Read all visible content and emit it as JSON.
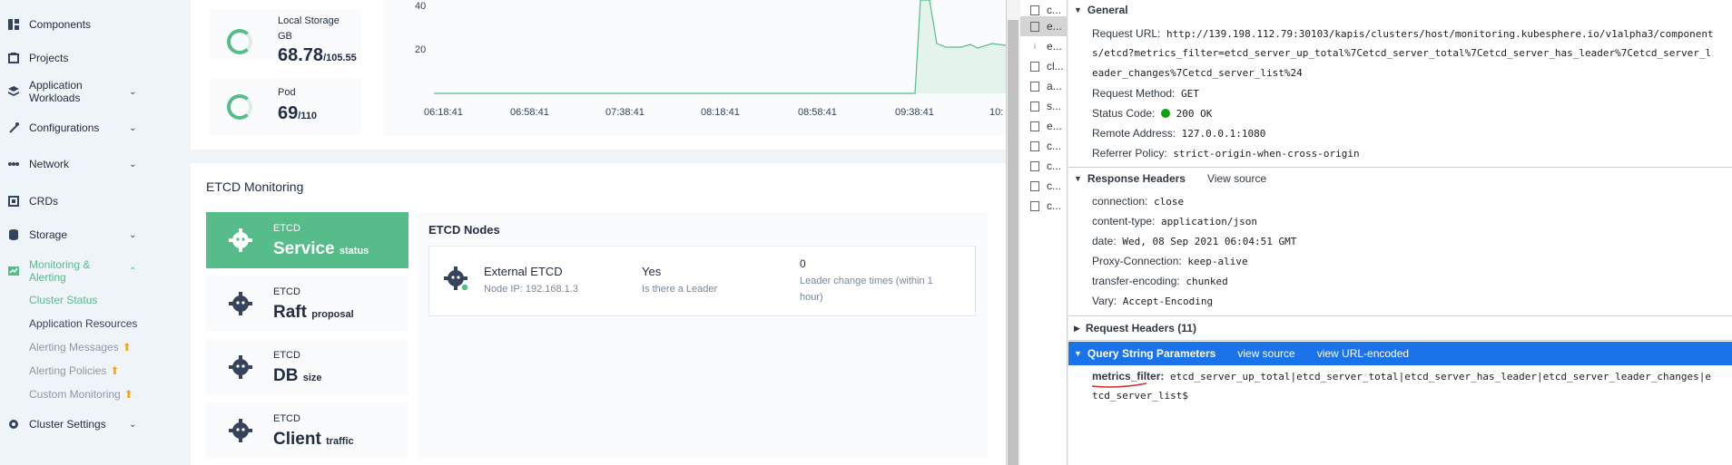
{
  "sidebar": {
    "items": [
      {
        "label": "Components",
        "icon": "components-icon"
      },
      {
        "label": "Projects",
        "icon": "projects-icon"
      },
      {
        "label": "Application Workloads",
        "icon": "workloads-icon"
      },
      {
        "label": "Configurations",
        "icon": "configurations-icon"
      },
      {
        "label": "Network",
        "icon": "network-icon"
      },
      {
        "label": "CRDs",
        "icon": "crds-icon"
      },
      {
        "label": "Storage",
        "icon": "storage-icon"
      },
      {
        "label": "Monitoring & Alerting",
        "icon": "monitoring-icon"
      },
      {
        "label": "Cluster Settings",
        "icon": "settings-icon"
      }
    ],
    "sub_items": [
      {
        "label": "Cluster Status"
      },
      {
        "label": "Application Resources"
      },
      {
        "label": "Alerting Messages"
      },
      {
        "label": "Alerting Policies"
      },
      {
        "label": "Custom Monitoring"
      }
    ]
  },
  "stats": [
    {
      "label1": "Local Storage",
      "label2": "GB",
      "value": "68.78",
      "total": "/105.55",
      "usage": 0.65
    },
    {
      "label1": "Pod",
      "label2": "",
      "value": "69",
      "total": "/110",
      "usage": 0.63
    }
  ],
  "chart": {
    "yticks": [
      "40",
      "20"
    ],
    "xticks": [
      "06:18:41",
      "06:58:41",
      "07:38:41",
      "08:18:41",
      "08:58:41",
      "09:38:41",
      "10:"
    ]
  },
  "etcd": {
    "title": "ETCD Monitoring",
    "cards": [
      {
        "kind": "ETCD",
        "big": "Service",
        "small": "status"
      },
      {
        "kind": "ETCD",
        "big": "Raft",
        "small": "proposal"
      },
      {
        "kind": "ETCD",
        "big": "DB",
        "small": "size"
      },
      {
        "kind": "ETCD",
        "big": "Client",
        "small": "traffic"
      }
    ],
    "nodes_title": "ETCD Nodes",
    "node": {
      "name": "External ETCD",
      "ip": "Node IP: 192.168.1.3",
      "leader_value": "Yes",
      "leader_label": "Is there a Leader",
      "changes_value": "0",
      "changes_label1": "Leader change times (within 1",
      "changes_label2": "hour)"
    }
  },
  "devtools": {
    "requests": [
      "c...",
      "e...",
      "e...",
      "cl...",
      "a...",
      "s...",
      "e...",
      "c...",
      "c...",
      "c...",
      "c..."
    ],
    "general": {
      "title": "General",
      "request_url_key": "Request URL:",
      "request_url_1": "http://139.198.112.79:30103/kapis/clusters/host/monitoring.kubesphere.io/v1alpha3/component",
      "request_url_2": "s/etcd?metrics_filter=etcd_server_up_total%7Cetcd_server_total%7Cetcd_server_has_leader%7Cetcd_server_l",
      "request_url_3": "eader_changes%7Cetcd_server_list%24",
      "method_key": "Request Method:",
      "method": "GET",
      "status_key": "Status Code:",
      "status": "200 OK",
      "remote_key": "Remote Address:",
      "remote": "127.0.0.1:1080",
      "referrer_key": "Referrer Policy:",
      "referrer": "strict-origin-when-cross-origin"
    },
    "response": {
      "title": "Response Headers",
      "view_source": "View source",
      "headers": [
        {
          "k": "connection:",
          "v": "close"
        },
        {
          "k": "content-type:",
          "v": "application/json"
        },
        {
          "k": "date:",
          "v": "Wed, 08 Sep 2021 06:04:51 GMT"
        },
        {
          "k": "Proxy-Connection:",
          "v": "keep-alive"
        },
        {
          "k": "transfer-encoding:",
          "v": "chunked"
        },
        {
          "k": "Vary:",
          "v": "Accept-Encoding"
        }
      ]
    },
    "request_headers": {
      "title": "Request Headers (11)"
    },
    "query": {
      "title": "Query String Parameters",
      "view_source": "view source",
      "view_url": "view URL-encoded",
      "key": "metrics_filter:",
      "value_1": "etcd_server_up_total|etcd_server_total|etcd_server_has_leader|etcd_server_leader_changes|e",
      "value_2": "tcd_server_list$"
    }
  }
}
